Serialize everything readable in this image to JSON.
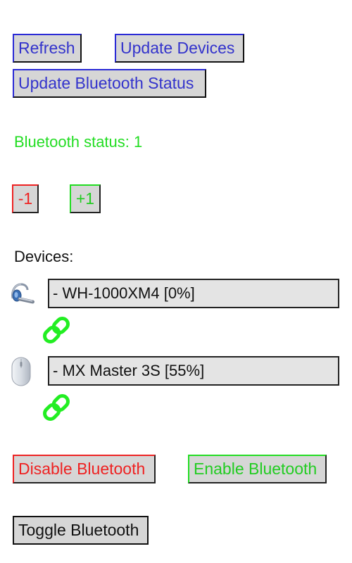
{
  "toolbar": {
    "refresh_label": "Refresh",
    "update_devices_label": "Update Devices",
    "update_bluetooth_status_label": "Update Bluetooth Status"
  },
  "status": {
    "text": "Bluetooth status: 1",
    "color": "#22dd22"
  },
  "stepper": {
    "decrement_label": "-1",
    "increment_label": "+1"
  },
  "devices": {
    "heading": "Devices:",
    "items": [
      {
        "label": "- WH-1000XM4 [0%]",
        "icon": "headset-icon",
        "link_icon": "link-icon"
      },
      {
        "label": "- MX Master 3S [55%]",
        "icon": "mouse-icon",
        "link_icon": "link-icon"
      }
    ]
  },
  "actions": {
    "disable_label": "Disable Bluetooth",
    "enable_label": "Enable Bluetooth",
    "toggle_label": "Toggle Bluetooth"
  },
  "colors": {
    "blue_text": "#3333cc",
    "red": "#ee2222",
    "green": "#22dd22",
    "button_bg": "#d6d6d6",
    "device_bg": "#e4e4e4"
  }
}
